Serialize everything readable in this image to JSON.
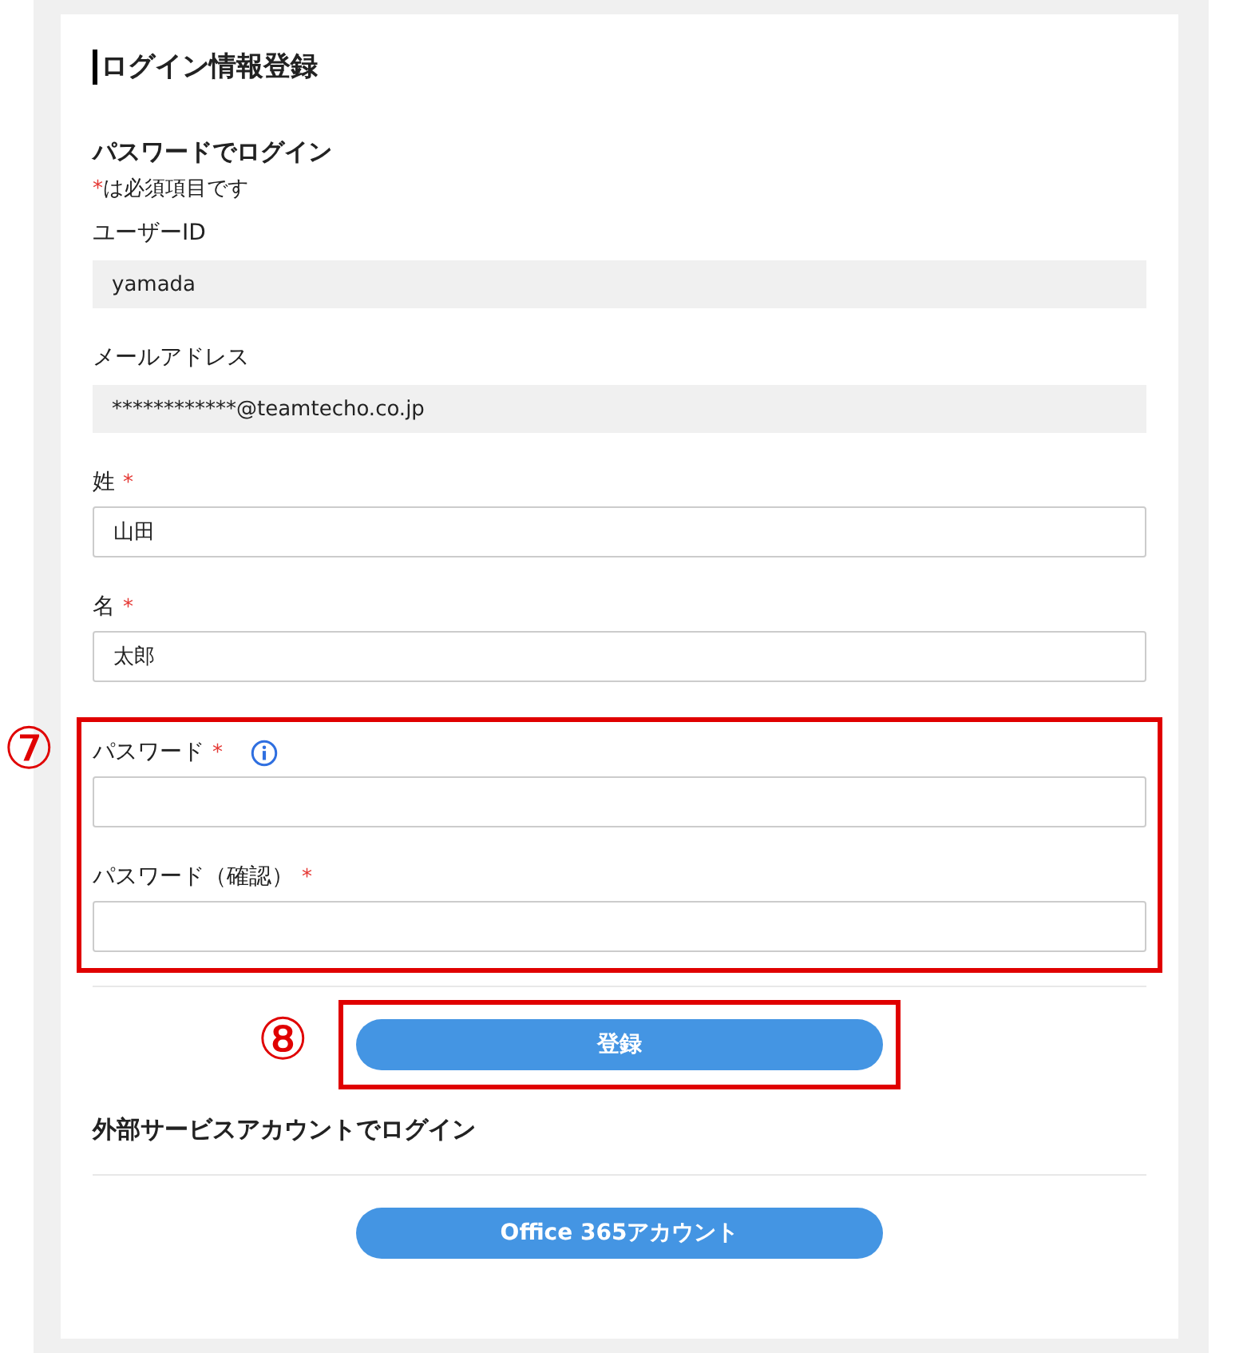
{
  "title": "ログイン情報登録",
  "password_login": {
    "heading": "パスワードでログイン",
    "required_note": {
      "mark": "*",
      "text": "は必須項目です"
    },
    "fields": [
      {
        "kind": "readonly",
        "label": "ユーザーID",
        "value": "yamada",
        "info": false
      },
      {
        "kind": "readonly",
        "label": "メールアドレス",
        "value": "************@teamtecho.co.jp",
        "info": false
      },
      {
        "kind": "input",
        "label": "姓",
        "required_mark": "*",
        "value": "山田",
        "info": false
      },
      {
        "kind": "input",
        "label": "名",
        "required_mark": "*",
        "value": "太郎",
        "info": false
      }
    ],
    "password_group": {
      "callout": "⑦",
      "fields": [
        {
          "kind": "input",
          "label": "パスワード",
          "required_mark": "*",
          "info": true
        },
        {
          "kind": "input",
          "label": "パスワード（確認）",
          "required_mark": "*",
          "info": false
        }
      ]
    },
    "submit_button": {
      "label": "登録",
      "callout": "⑧"
    }
  },
  "external_login": {
    "heading": "外部サービスアカウントでログイン",
    "buttons": [
      {
        "label": "Office 365アカウント"
      }
    ]
  }
}
